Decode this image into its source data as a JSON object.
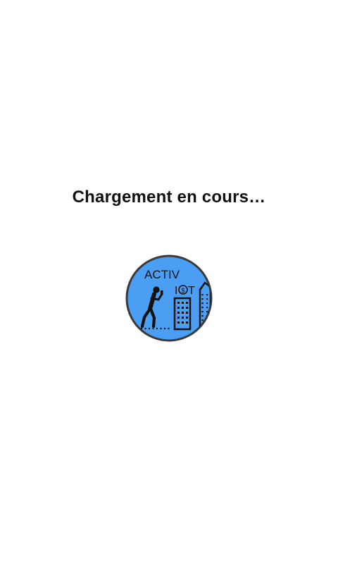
{
  "status": {
    "loading_text": "Chargement en cours…"
  },
  "logo": {
    "line1": "ACTIV",
    "line2_left": "I",
    "line2_right": "T",
    "coin_symbol": "$",
    "background_color": "#4a9ff5",
    "border_color": "#3a3a3a",
    "figure_icon": "walking-person-icon",
    "building_icon": "building-icon"
  }
}
